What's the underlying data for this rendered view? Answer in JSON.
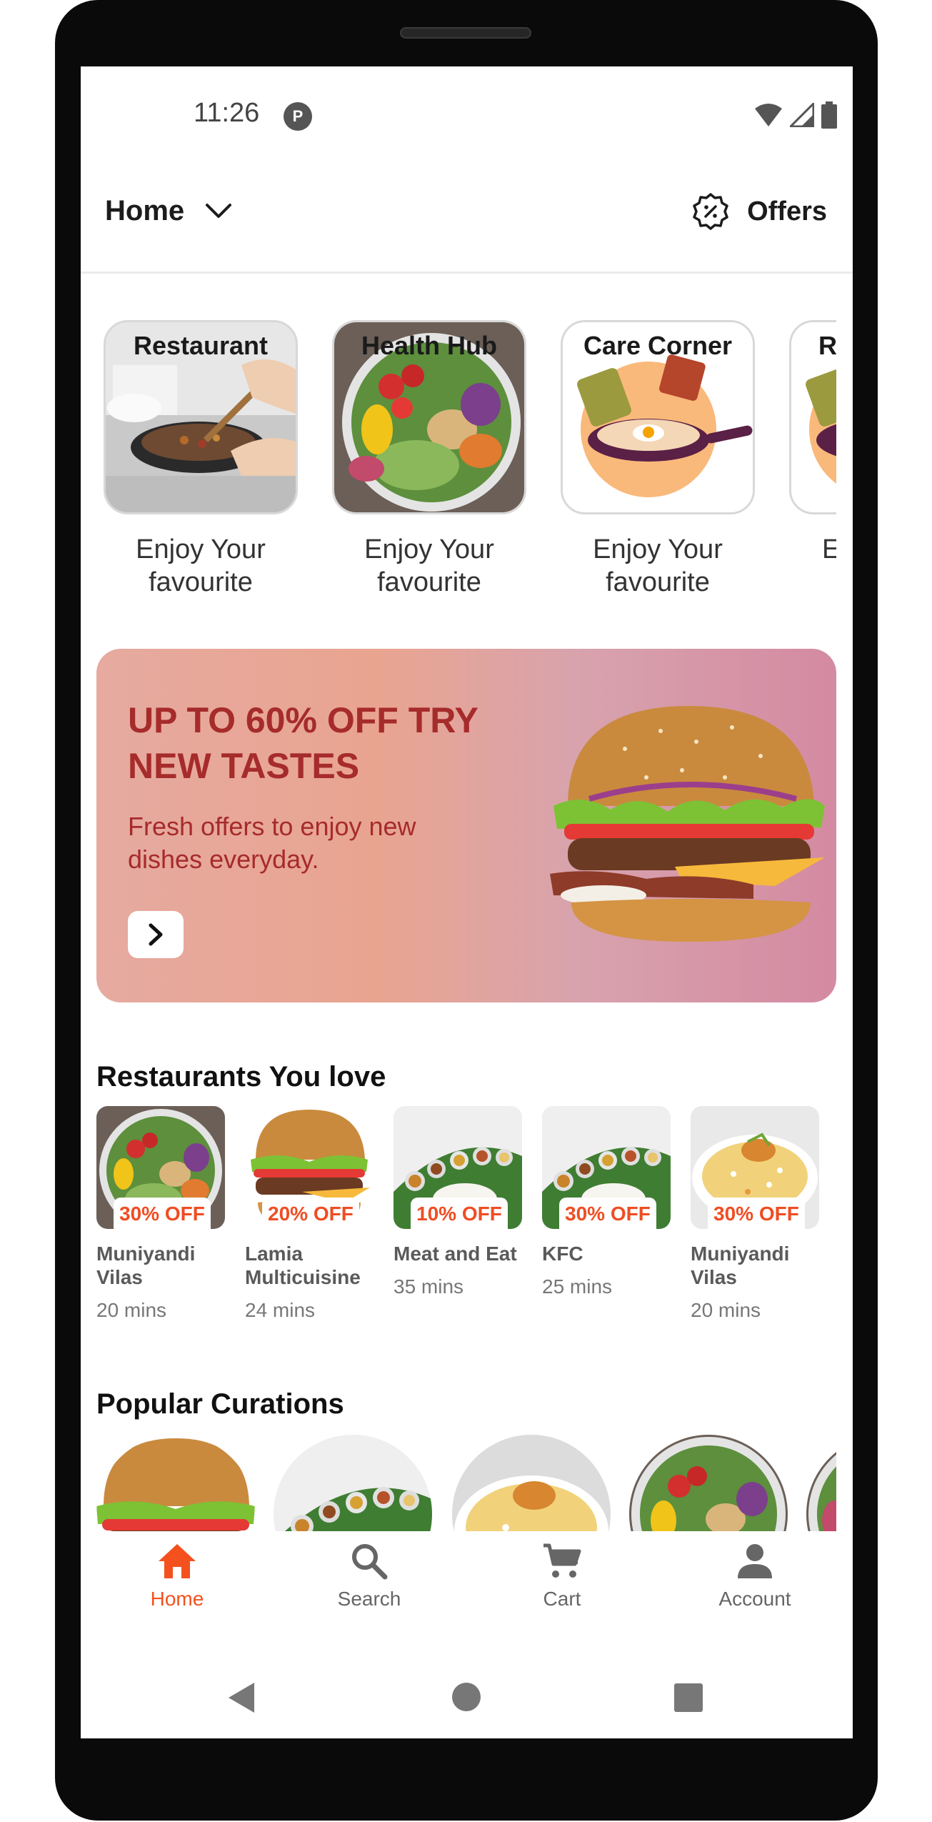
{
  "status_bar": {
    "time": "11:26",
    "app_icon": "notification-app-icon",
    "icons": [
      "wifi-icon",
      "cellular-signal-icon",
      "battery-icon"
    ]
  },
  "header": {
    "location_label": "Home",
    "location_icon": "chevron-down-icon",
    "offers_label": "Offers",
    "offers_icon": "discount-badge-icon"
  },
  "categories": [
    {
      "title": "Restaurant",
      "subtitle": "Enjoy Your favourite"
    },
    {
      "title": "Health Hub",
      "subtitle": "Enjoy Your favourite"
    },
    {
      "title": "Care Corner",
      "subtitle": "Enjoy Your favourite"
    },
    {
      "title": "R",
      "subtitle": "E f"
    }
  ],
  "banner": {
    "title": "UP TO 60% OFF TRY NEW TASTES",
    "subtitle": "Fresh offers to enjoy new dishes everyday.",
    "button_icon": "chevron-right-icon"
  },
  "sections": {
    "restaurants_title": "Restaurants You love",
    "curations_title": "Popular Curations"
  },
  "restaurants": [
    {
      "name": "Muniyandi Vilas",
      "time": "20 mins",
      "offer": "30% OFF",
      "image": "salad-bowl"
    },
    {
      "name": "Lamia Multicuisine",
      "time": "24 mins",
      "offer": "20% OFF",
      "image": "burger"
    },
    {
      "name": "Meat and Eat",
      "time": "35 mins",
      "offer": "10% OFF",
      "image": "banana-leaf-meal"
    },
    {
      "name": "KFC",
      "time": "25 mins",
      "offer": "30% OFF",
      "image": "banana-leaf-meal"
    },
    {
      "name": "Muniyandi Vilas",
      "time": "20 mins",
      "offer": "30% OFF",
      "image": "biryani"
    }
  ],
  "curations": [
    "burger",
    "banana-leaf-meal",
    "biryani",
    "salad-bowl",
    "salad-bowl"
  ],
  "bottom_nav": [
    {
      "label": "Home",
      "icon": "home-icon",
      "active": true
    },
    {
      "label": "Search",
      "icon": "search-icon",
      "active": false
    },
    {
      "label": "Cart",
      "icon": "cart-icon",
      "active": false
    },
    {
      "label": "Account",
      "icon": "account-icon",
      "active": false
    }
  ],
  "system_nav": [
    "back-icon",
    "home-circle-icon",
    "recents-icon"
  ],
  "colors": {
    "accent": "#f4511e",
    "banner_text": "#a62b2b",
    "badge_text": "#ef4d23"
  }
}
